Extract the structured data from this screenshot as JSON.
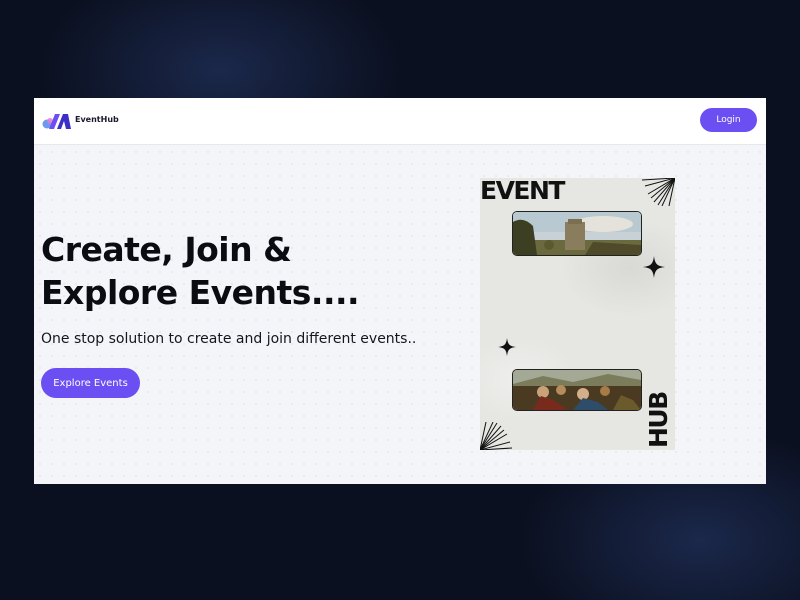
{
  "navbar": {
    "brand": "EventHub",
    "login_label": "Login",
    "logo_colors": [
      "#5b8ef0",
      "#e07bd4",
      "#6b4ff2",
      "#3b2fc7"
    ]
  },
  "hero": {
    "title_line1": "Create, Join &",
    "title_line2": "Explore Events....",
    "subtitle": "One stop solution to create and join different events..",
    "cta_label": "Explore Events"
  },
  "poster": {
    "top_text": "EVENT",
    "side_text": "HUB"
  },
  "colors": {
    "accent": "#6b4ff2",
    "background": "#0b1020",
    "page": "#f4f5f9"
  }
}
